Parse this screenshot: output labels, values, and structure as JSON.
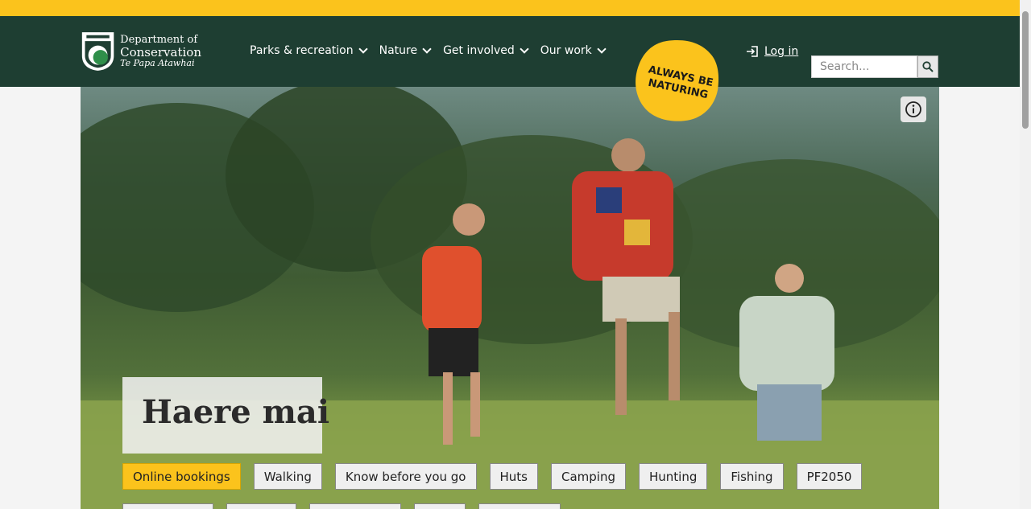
{
  "logo": {
    "line1": "Department of",
    "line2": "Conservation",
    "line3": "Te Papa Atawhai"
  },
  "nav": [
    {
      "label": "Parks & recreation"
    },
    {
      "label": "Nature"
    },
    {
      "label": "Get involved"
    },
    {
      "label": "Our work"
    }
  ],
  "badge": {
    "line1": "ALWAYS BE",
    "line2": "NATURING"
  },
  "login": {
    "label": "Log in"
  },
  "search": {
    "placeholder": "Search..."
  },
  "hero": {
    "title": "Haere mai"
  },
  "chips": [
    {
      "label": "Online bookings"
    },
    {
      "label": "Walking"
    },
    {
      "label": "Know before you go"
    },
    {
      "label": "Huts"
    },
    {
      "label": "Camping"
    },
    {
      "label": "Hunting"
    },
    {
      "label": "Fishing"
    },
    {
      "label": "PF2050"
    }
  ],
  "colors": {
    "brand_green": "#1e3e32",
    "accent_yellow": "#fbc31c"
  }
}
